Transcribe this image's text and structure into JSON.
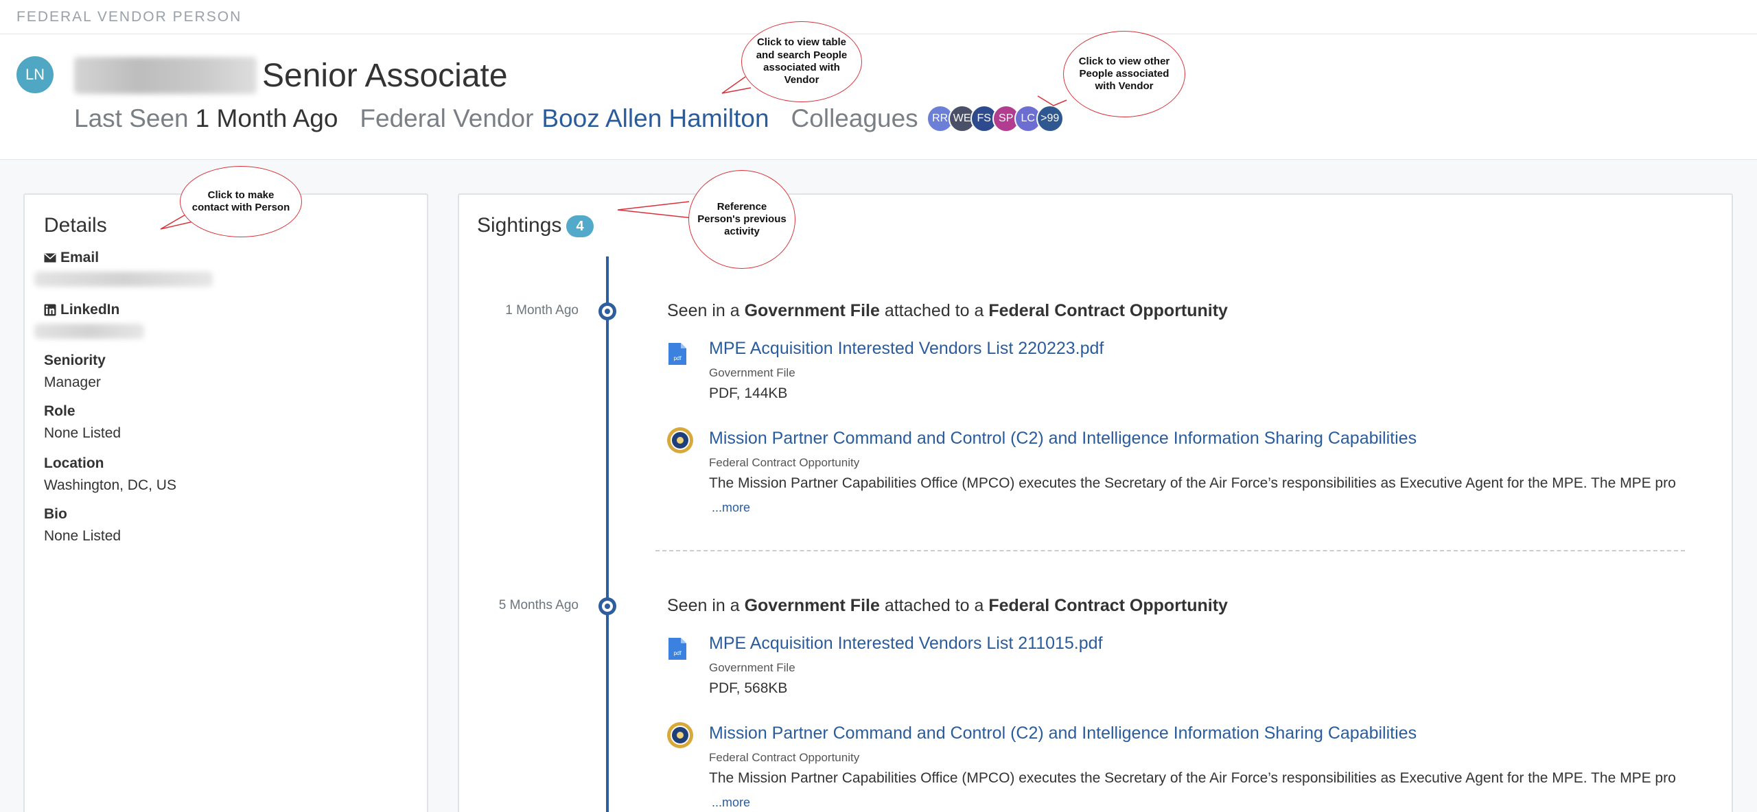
{
  "topbar": {
    "title": "FEDERAL VENDOR PERSON"
  },
  "person": {
    "initials": "LN",
    "title": "Senior Associate",
    "last_seen_label": "Last Seen",
    "last_seen_value": "1 Month Ago",
    "vendor_label": "Federal Vendor",
    "vendor_name": "Booz Allen Hamilton",
    "colleagues_label": "Colleagues",
    "colleagues": [
      {
        "initials": "RR",
        "color": "#6b7fd6"
      },
      {
        "initials": "WE",
        "color": "#4a5068"
      },
      {
        "initials": "FS",
        "color": "#2e4a8f"
      },
      {
        "initials": "SP",
        "color": "#b23c8f"
      },
      {
        "initials": "LC",
        "color": "#6c6fd1"
      },
      {
        "initials": ">99",
        "color": "#2f5790"
      }
    ]
  },
  "callouts": {
    "vendor": "Click to view table and search People associated with Vendor",
    "colleagues": "Click to view other People associated with Vendor",
    "contact": "Click to make contact with Person",
    "sightings": "Reference Person's previous activity"
  },
  "details": {
    "title": "Details",
    "email_label": "Email",
    "linkedin_label": "LinkedIn",
    "seniority_label": "Seniority",
    "seniority_value": "Manager",
    "role_label": "Role",
    "role_value": "None Listed",
    "location_label": "Location",
    "location_value": "Washington, DC, US",
    "bio_label": "Bio",
    "bio_value": "None Listed"
  },
  "sightings": {
    "title": "Sightings",
    "count": "4",
    "entries": [
      {
        "time_ago": "1 Month Ago",
        "head_prefix": "Seen in a",
        "head_source": "Government File",
        "head_middle": "attached to a",
        "head_target": "Federal Contract Opportunity",
        "file_title": "MPE Acquisition Interested Vendors List 220223.pdf",
        "file_type": "Government File",
        "file_info": "PDF, 144KB",
        "opp_title": "Mission Partner Command and Control (C2) and Intelligence Information Sharing Capabilities",
        "opp_type": "Federal Contract Opportunity",
        "opp_desc": "The Mission Partner Capabilities Office (MPCO) executes the Secretary of the Air Force’s responsibilities as Executive Agent for the MPE.  The MPE pro",
        "more_label": "...more"
      },
      {
        "time_ago": "5 Months Ago",
        "head_prefix": "Seen in a",
        "head_source": "Government File",
        "head_middle": "attached to a",
        "head_target": "Federal Contract Opportunity",
        "file_title": "MPE Acquisition Interested Vendors List 211015.pdf",
        "file_type": "Government File",
        "file_info": "PDF, 568KB",
        "opp_title": "Mission Partner Command and Control (C2) and Intelligence Information Sharing Capabilities",
        "opp_type": "Federal Contract Opportunity",
        "opp_desc": "The Mission Partner Capabilities Office (MPCO) executes the Secretary of the Air Force’s responsibilities as Executive Agent for the MPE.  The MPE pro",
        "more_label": "...more"
      }
    ]
  },
  "icons": {
    "email": "envelope-icon",
    "linkedin": "linkedin-icon",
    "pdf": "pdf-file-icon",
    "seal": "air-force-seal-icon"
  }
}
